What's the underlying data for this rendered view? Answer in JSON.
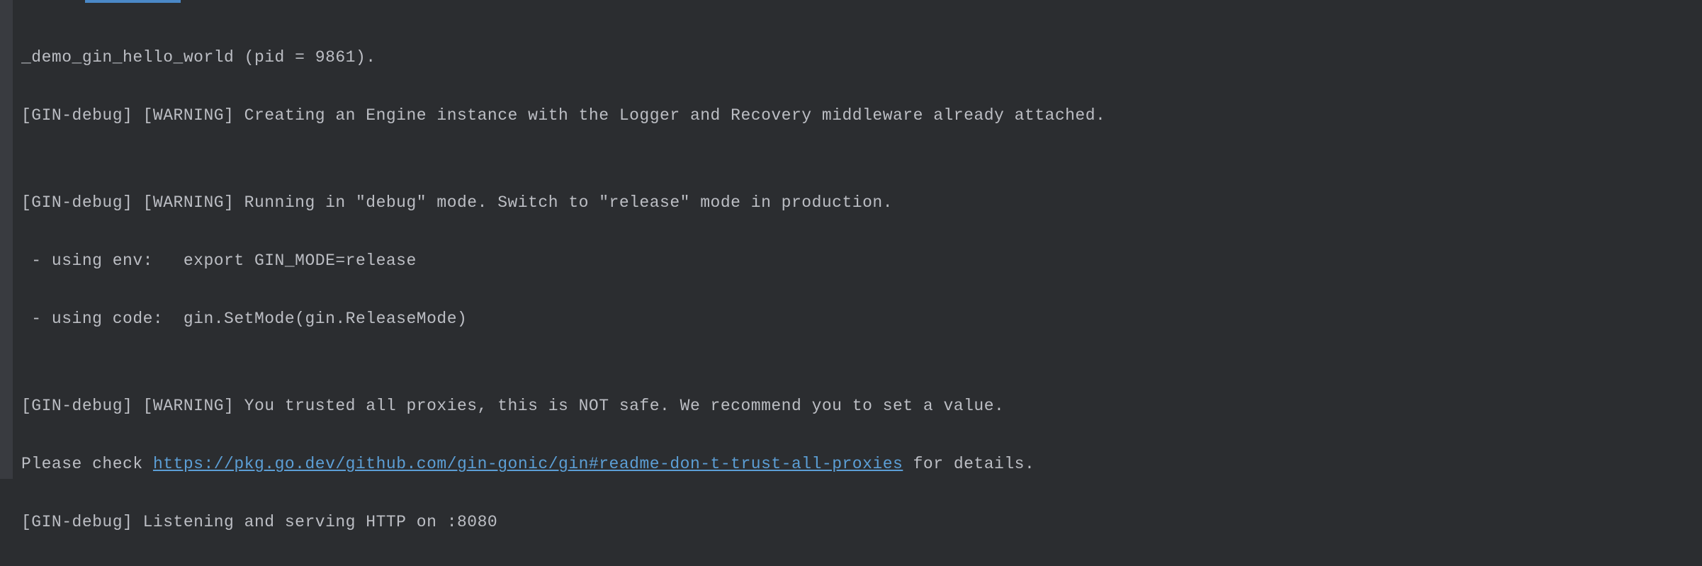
{
  "console": {
    "lines": [
      "_demo_gin_hello_world (pid = 9861).",
      "[GIN-debug] [WARNING] Creating an Engine instance with the Logger and Recovery middleware already attached.",
      "",
      "[GIN-debug] [WARNING] Running in \"debug\" mode. Switch to \"release\" mode in production.",
      " - using env:   export GIN_MODE=release",
      " - using code:  gin.SetMode(gin.ReleaseMode)",
      "",
      "[GIN-debug] [WARNING] You trusted all proxies, this is NOT safe. We recommend you to set a value."
    ],
    "link_line_prefix": "Please check ",
    "link_url": "https://pkg.go.dev/github.com/gin-gonic/gin#readme-don-t-trust-all-proxies",
    "link_line_suffix": " for details.",
    "last_line": "[GIN-debug] Listening and serving HTTP on :8080"
  }
}
